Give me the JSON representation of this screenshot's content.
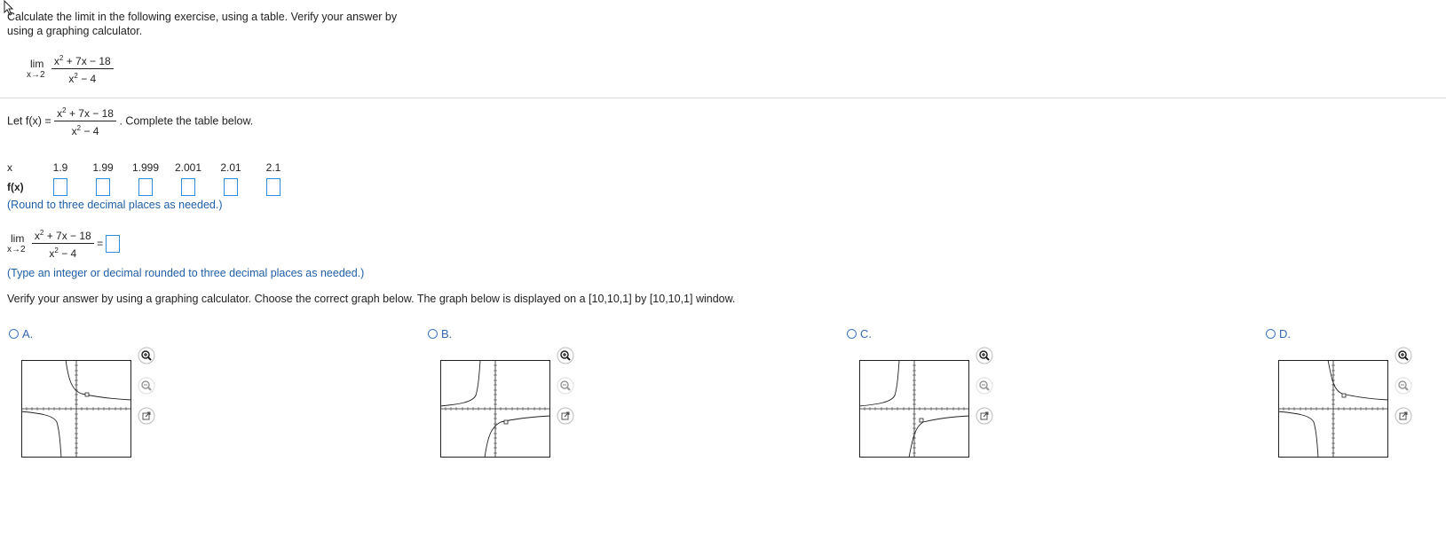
{
  "question": {
    "text": "Calculate the limit in the following exercise, using a table. Verify your answer by using a graphing calculator."
  },
  "limit": {
    "lim": "lim",
    "approach": "x→2",
    "numerator": "x² + 7x − 18",
    "denominator": "x² − 4",
    "equals": "="
  },
  "let": {
    "prefix": "Let f(x) =",
    "suffix": ". Complete the table below."
  },
  "table": {
    "x_label": "x",
    "fx_label": "f(x)",
    "x_values": [
      "1.9",
      "1.99",
      "1.999",
      "2.001",
      "2.01",
      "2.1"
    ],
    "round_note": "(Round to three decimal places as needed.)"
  },
  "answer_note": "(Type an integer or decimal rounded to three decimal places as needed.)",
  "verify_text": "Verify your answer by using a graphing calculator. Choose the correct graph below. The graph below is displayed on a [10,10,1] by [10,10,1] window.",
  "options": [
    {
      "label": "A."
    },
    {
      "label": "B."
    },
    {
      "label": "C."
    },
    {
      "label": "D."
    }
  ],
  "colors": {
    "link_blue": "#3469b0",
    "input_border": "#2f8ad8",
    "note_blue": "#1f5fa8"
  },
  "icons": [
    "zoom-in-icon",
    "zoom-out-icon",
    "popout-icon",
    "cursor-icon"
  ]
}
